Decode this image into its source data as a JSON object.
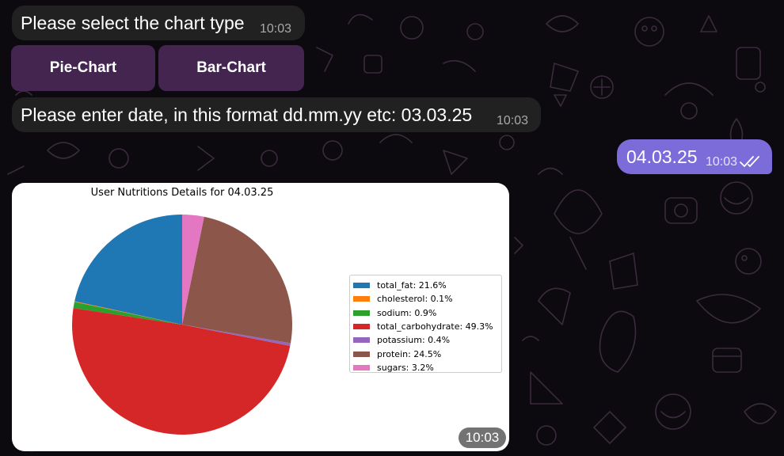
{
  "chat": {
    "messages": [
      {
        "text": "Please select the chart type",
        "time": "10:03"
      },
      {
        "text": "Please enter date, in this format dd.mm.yy etc: 03.03.25",
        "time": "10:03"
      }
    ],
    "keyboard": {
      "buttons": [
        "Pie-Chart",
        "Bar-Chart"
      ]
    },
    "outgoing": {
      "text": "04.03.25",
      "time": "10:03"
    },
    "photo": {
      "time": "10:03"
    }
  },
  "colors": {
    "background": "#0c0a0e",
    "incoming_bubble": "#212121",
    "outgoing_bubble": "#7b6cd9",
    "keyboard_button": "#4d2a5c"
  },
  "chart_data": {
    "type": "pie",
    "title": "User Nutritions Details for 04.03.25",
    "legend_position": "right",
    "start_angle_deg": 90,
    "direction": "counterclockwise",
    "slices": [
      {
        "label": "total_fat: 21.6%",
        "value": 21.6,
        "color": "#1f77b4"
      },
      {
        "label": "cholesterol: 0.1%",
        "value": 0.1,
        "color": "#ff7f0e"
      },
      {
        "label": "sodium: 0.9%",
        "value": 0.9,
        "color": "#2ca02c"
      },
      {
        "label": "total_carbohydrate: 49.3%",
        "value": 49.3,
        "color": "#d62728"
      },
      {
        "label": "potassium: 0.4%",
        "value": 0.4,
        "color": "#9467bd"
      },
      {
        "label": "protein: 24.5%",
        "value": 24.5,
        "color": "#8c564b"
      },
      {
        "label": "sugars: 3.2%",
        "value": 3.2,
        "color": "#e377c2"
      }
    ]
  }
}
